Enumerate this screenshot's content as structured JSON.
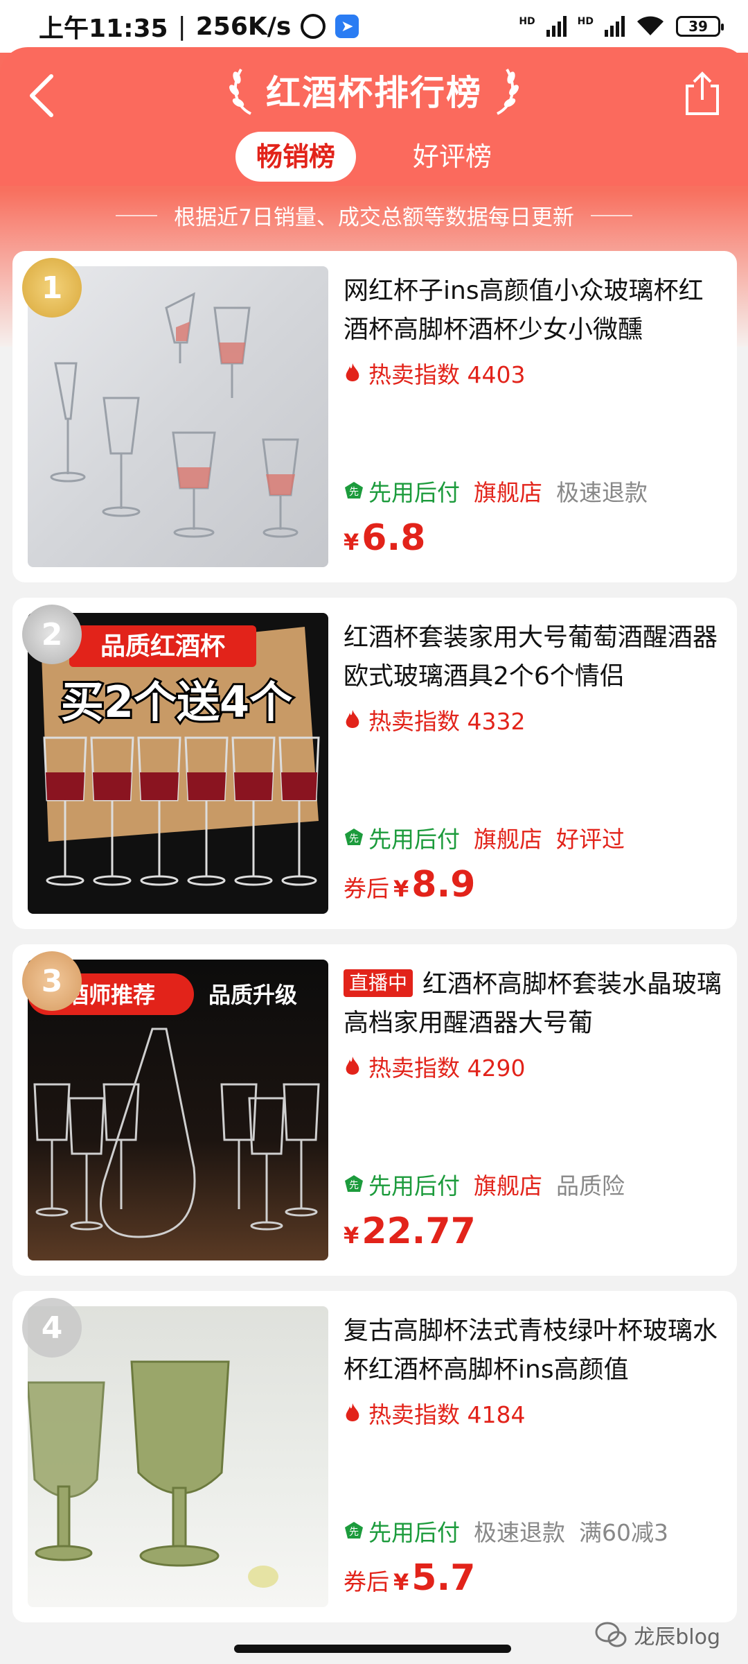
{
  "status_bar": {
    "time": "上午11:35",
    "separator": "|",
    "speed": "256K/s",
    "net_label_1": "HD",
    "net_label_2": "HD",
    "battery": "39"
  },
  "header": {
    "title": "红酒杯排行榜",
    "tabs": [
      {
        "label": "畅销榜",
        "active": true
      },
      {
        "label": "好评榜",
        "active": false
      }
    ],
    "subtitle": "根据近7日销量、成交总额等数据每日更新"
  },
  "colors": {
    "accent_red": "#e2231a",
    "header_bg": "#fb6a5d",
    "green": "#1c9b3c"
  },
  "products": [
    {
      "rank": "1",
      "title": "网红杯子ins高颜值小众玻璃杯红酒杯高脚杯酒杯少女小微醺",
      "hot_label": "热卖指数 4403",
      "perk_main": "先用后付",
      "perk_2": "旗舰店",
      "perk_3": "极速退款",
      "coupon": "",
      "yen": "¥",
      "price": "6.8"
    },
    {
      "rank": "2",
      "title": "红酒杯套装家用大号葡萄酒醒酒器欧式玻璃酒具2个6个情侣",
      "hot_label": "热卖指数 4332",
      "perk_main": "先用后付",
      "perk_2": "旗舰店",
      "perk_3": "好评过",
      "coupon": "券后",
      "yen": "¥",
      "price": "8.9",
      "image_text_1": "品质红酒杯",
      "image_text_2": "买2个送4个"
    },
    {
      "rank": "3",
      "live": "直播中",
      "title": "红酒杯高脚杯套装水晶玻璃高档家用醒酒器大号葡",
      "hot_label": "热卖指数 4290",
      "perk_main": "先用后付",
      "perk_2": "旗舰店",
      "perk_3": "品质险",
      "coupon": "",
      "yen": "¥",
      "price": "22.77",
      "image_text_1": "酒师推荐",
      "image_text_2": "品质升级"
    },
    {
      "rank": "4",
      "title": "复古高脚杯法式青枝绿叶杯玻璃水杯红酒杯高脚杯ins高颜值",
      "hot_label": "热卖指数 4184",
      "perk_main": "先用后付",
      "perk_2": "极速退款",
      "perk_3": "满60减3",
      "coupon": "券后",
      "yen": "¥",
      "price": "5.7"
    }
  ],
  "watermark": "龙辰blog"
}
